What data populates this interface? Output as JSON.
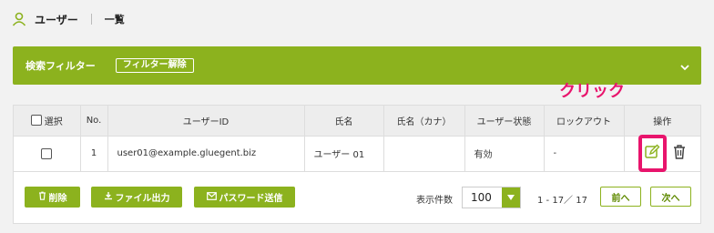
{
  "header": {
    "title": "ユーザー",
    "subtitle": "一覧"
  },
  "filter": {
    "label": "検索フィルター",
    "clear_label": "フィルター解除"
  },
  "table": {
    "select_label": "選択",
    "columns": [
      "No.",
      "ユーザーID",
      "氏名",
      "氏名（カナ）",
      "ユーザー状態",
      "ロックアウト",
      "操作"
    ],
    "rows": [
      {
        "no": "1",
        "user_id": "user01@example.gluegent.biz",
        "name": "ユーザー 01",
        "kana": "",
        "status": "有効",
        "lockout": "-"
      }
    ]
  },
  "footer": {
    "delete_label": "削除",
    "export_label": "ファイル出力",
    "password_label": "パスワード送信",
    "count_label": "表示件数",
    "page_size": "100",
    "range_text": "1 - 17／ 17",
    "prev_label": "前へ",
    "next_label": "次へ"
  },
  "annotation": "クリック",
  "colors": {
    "accent": "#8cb21e",
    "highlight": "#e8146c"
  }
}
